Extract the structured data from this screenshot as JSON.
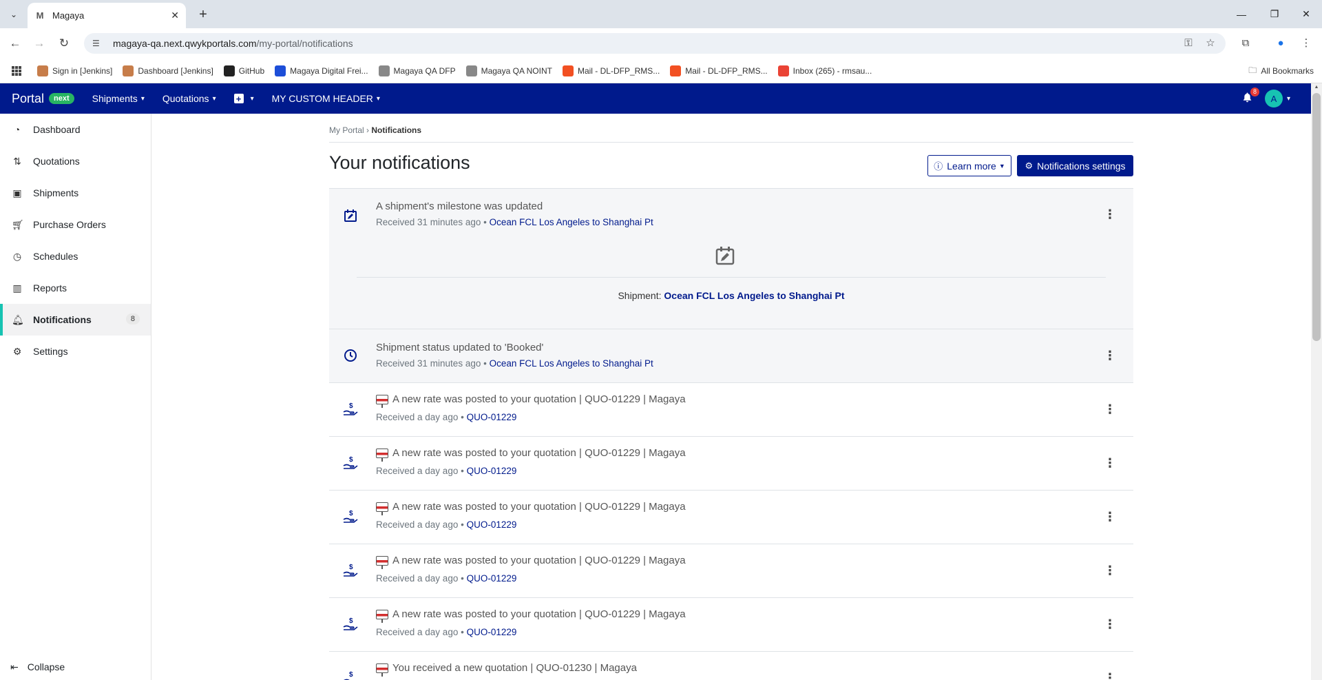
{
  "browser": {
    "tab_title": "Magaya",
    "url_host": "magaya-qa.next.qwykportals.com",
    "url_path": "/my-portal/notifications",
    "bookmarks": [
      {
        "label": "Sign in [Jenkins]",
        "color": "#c77d4a"
      },
      {
        "label": "Dashboard [Jenkins]",
        "color": "#c77d4a"
      },
      {
        "label": "GitHub",
        "color": "#222222"
      },
      {
        "label": "Magaya Digital Frei...",
        "color": "#1d4ed8"
      },
      {
        "label": "Magaya QA DFP",
        "color": "#888888"
      },
      {
        "label": "Magaya QA NOINT",
        "color": "#888888"
      },
      {
        "label": "Mail - DL-DFP_RMS...",
        "color": "#f25022"
      },
      {
        "label": "Mail - DL-DFP_RMS...",
        "color": "#f25022"
      },
      {
        "label": "Inbox (265) - rmsau...",
        "color": "#ea4335"
      }
    ],
    "all_bookmarks": "All Bookmarks"
  },
  "header": {
    "brand": "Portal",
    "brand_badge": "next",
    "nav": [
      "Shipments",
      "Quotations",
      "MY CUSTOM HEADER"
    ],
    "notification_count": "8",
    "avatar_initial": "A"
  },
  "sidebar": {
    "items": [
      {
        "label": "Dashboard",
        "icon": "dashboard-icon"
      },
      {
        "label": "Quotations",
        "icon": "quotations-icon"
      },
      {
        "label": "Shipments",
        "icon": "shipments-icon"
      },
      {
        "label": "Purchase Orders",
        "icon": "cart-icon"
      },
      {
        "label": "Schedules",
        "icon": "clock-icon"
      },
      {
        "label": "Reports",
        "icon": "chart-icon"
      },
      {
        "label": "Notifications",
        "icon": "bell-icon",
        "count": "8"
      },
      {
        "label": "Settings",
        "icon": "gear-icon"
      }
    ],
    "collapse": "Collapse"
  },
  "main": {
    "breadcrumb_root": "My Portal",
    "breadcrumb_sep": "›",
    "breadcrumb_current": "Notifications",
    "title": "Your notifications",
    "learn_more": "Learn more",
    "settings_button": "Notifications settings",
    "notifications": [
      {
        "title": "A shipment's milestone was updated",
        "received": "Received 31 minutes ago",
        "link": "Ocean FCL Los Angeles to Shanghai Pt",
        "icon": "calendar-edit-icon",
        "expanded_label": "Shipment:",
        "expanded_link": "Ocean FCL Los Angeles to Shanghai Pt"
      },
      {
        "title": "Shipment status updated to 'Booked'",
        "received": "Received 31 minutes ago",
        "link": "Ocean FCL Los Angeles to Shanghai Pt",
        "icon": "clock-icon"
      },
      {
        "title": "A new rate was posted to your quotation | QUO-01229 | Magaya",
        "received": "Received a day ago",
        "link": "QUO-01229",
        "icon": "hand-dollar-icon"
      },
      {
        "title": "A new rate was posted to your quotation | QUO-01229 | Magaya",
        "received": "Received a day ago",
        "link": "QUO-01229",
        "icon": "hand-dollar-icon"
      },
      {
        "title": "A new rate was posted to your quotation | QUO-01229 | Magaya",
        "received": "Received a day ago",
        "link": "QUO-01229",
        "icon": "hand-dollar-icon"
      },
      {
        "title": "A new rate was posted to your quotation | QUO-01229 | Magaya",
        "received": "Received a day ago",
        "link": "QUO-01229",
        "icon": "hand-dollar-icon"
      },
      {
        "title": "A new rate was posted to your quotation | QUO-01229 | Magaya",
        "received": "Received a day ago",
        "link": "QUO-01229",
        "icon": "hand-dollar-icon"
      },
      {
        "title": "You received a new quotation | QUO-01230 | Magaya",
        "received": "",
        "link": "",
        "icon": "hand-dollar-icon"
      }
    ]
  }
}
